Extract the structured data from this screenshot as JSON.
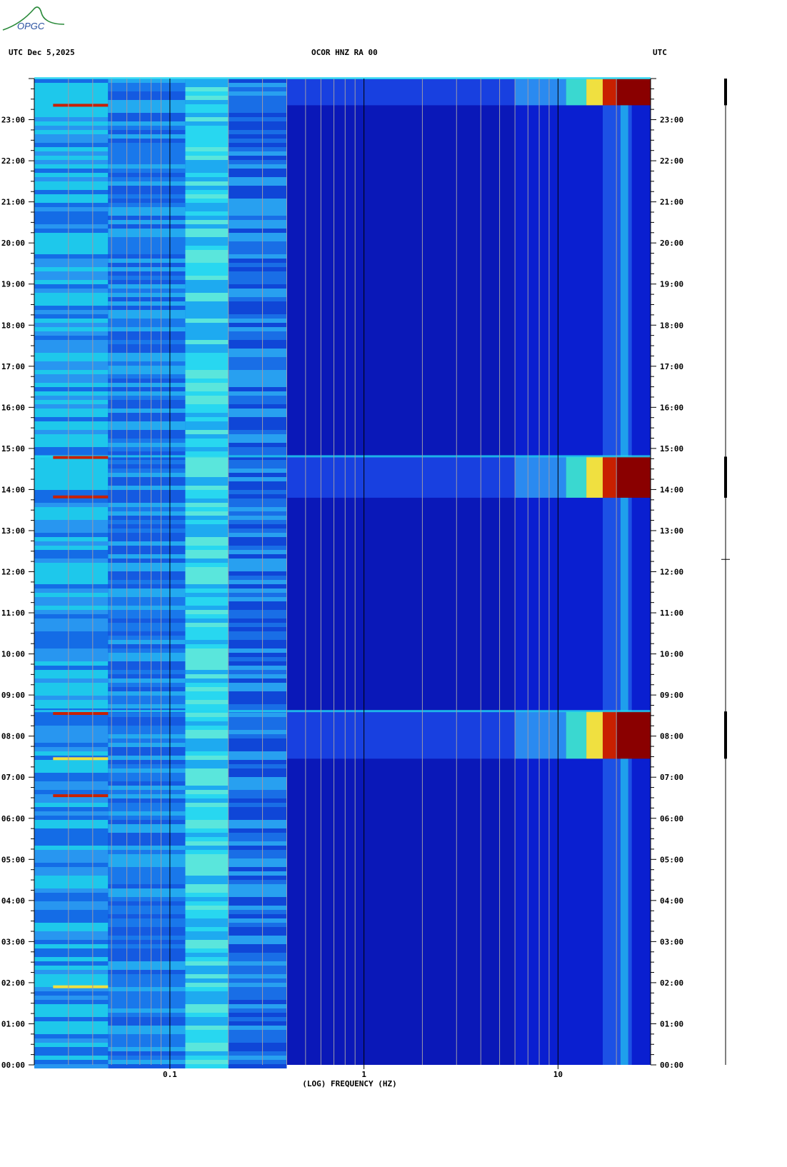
{
  "header": {
    "left": "UTC  Dec 5,2025",
    "center": "OCOR HNZ RA 00",
    "right": "UTC",
    "logo_text": "OPGC"
  },
  "colors": {
    "background": "#0a1fd0",
    "quiet": "#0a18b8",
    "low_band": "#1a6cf0",
    "cyan": "#22d4f0",
    "yellow": "#f0e040",
    "red": "#c82000",
    "dark_red": "#8a0000",
    "grid": "#9a9aaa",
    "decade": "#000000"
  },
  "chart_data": {
    "type": "heatmap",
    "title": "OCOR HNZ RA 00",
    "xlabel": "(LOG) FREQUENCY (HZ)",
    "ylabel": "UTC",
    "x_scale": "log",
    "xlim": [
      0.02,
      30
    ],
    "ylim": [
      0,
      24
    ],
    "x_ticks": [
      {
        "value": 0.1,
        "label": "0.1"
      },
      {
        "value": 1,
        "label": "1"
      },
      {
        "value": 10,
        "label": "10"
      }
    ],
    "y_ticks": [
      {
        "value": 0,
        "label": "00:00"
      },
      {
        "value": 1,
        "label": "01:00"
      },
      {
        "value": 2,
        "label": "02:00"
      },
      {
        "value": 3,
        "label": "03:00"
      },
      {
        "value": 4,
        "label": "04:00"
      },
      {
        "value": 5,
        "label": "05:00"
      },
      {
        "value": 6,
        "label": "06:00"
      },
      {
        "value": 7,
        "label": "07:00"
      },
      {
        "value": 8,
        "label": "08:00"
      },
      {
        "value": 9,
        "label": "09:00"
      },
      {
        "value": 10,
        "label": "10:00"
      },
      {
        "value": 11,
        "label": "11:00"
      },
      {
        "value": 12,
        "label": "12:00"
      },
      {
        "value": 13,
        "label": "13:00"
      },
      {
        "value": 14,
        "label": "14:00"
      },
      {
        "value": 15,
        "label": "15:00"
      },
      {
        "value": 16,
        "label": "16:00"
      },
      {
        "value": 17,
        "label": "17:00"
      },
      {
        "value": 18,
        "label": "18:00"
      },
      {
        "value": 19,
        "label": "19:00"
      },
      {
        "value": 20,
        "label": "20:00"
      },
      {
        "value": 21,
        "label": "21:00"
      },
      {
        "value": 22,
        "label": "22:00"
      },
      {
        "value": 23,
        "label": "23:00"
      }
    ],
    "high_energy_bands": [
      {
        "start": 7.45,
        "end": 8.6
      },
      {
        "start": 13.8,
        "end": 14.8
      },
      {
        "start": 23.35,
        "end": 24.0
      }
    ],
    "grid": true
  }
}
